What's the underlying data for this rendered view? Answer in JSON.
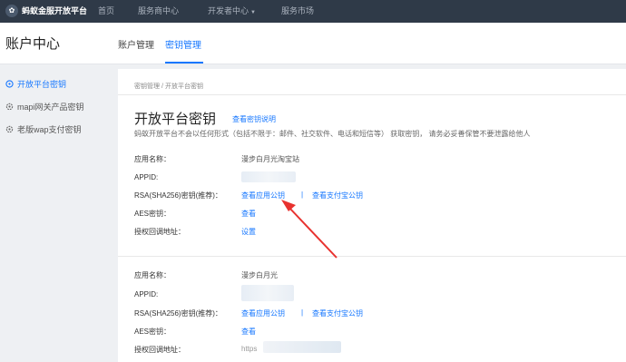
{
  "topbar": {
    "logo_glyph": "✿",
    "brand": "蚂蚁金服开放平台",
    "nav": [
      "首页",
      "服务商中心",
      "开发者中心",
      "服务市场"
    ],
    "dropdown_caret": "▼"
  },
  "header": {
    "title": "账户中心",
    "tabs": [
      "账户管理",
      "密钥管理"
    ],
    "active_tab": "密钥管理"
  },
  "sidebar": {
    "items": [
      "开放平台密钥",
      "mapi网关产品密钥",
      "老版wap支付密钥"
    ]
  },
  "breadcrumb": {
    "items": [
      "密钥管理",
      "开放平台密钥"
    ],
    "separator": "/"
  },
  "page": {
    "title": "开放平台密钥",
    "help_link": "查看密钥说明",
    "description": "蚂蚁开放平台不会以任何形式（包括不限于：邮件、社交软件、电话和短信等） 获取密钥， 请务必妥善保管不要泄露给他人"
  },
  "labels": {
    "app_name": "应用名称：",
    "appid": "APPID:",
    "rsa": "RSA(SHA256)密钥(推荐)：",
    "aes": "AES密钥：",
    "callback": "授权回调地址："
  },
  "apps": [
    {
      "name": "漫步白月光淘宝站",
      "rsa_link_1": "查看应用公钥",
      "pipe": "|",
      "rsa_link_2": "查看支付宝公钥",
      "aes_link": "查看",
      "callback_link": "设置"
    },
    {
      "name": "漫步白月光",
      "rsa_link_1": "查看应用公钥",
      "pipe": "|",
      "rsa_link_2": "查看支付宝公钥",
      "aes_link": "查看",
      "callback_value": "https"
    }
  ],
  "colors": {
    "accent": "#1677ff",
    "topbar": "#2f3a48",
    "annotation_arrow": "#e8322f"
  }
}
